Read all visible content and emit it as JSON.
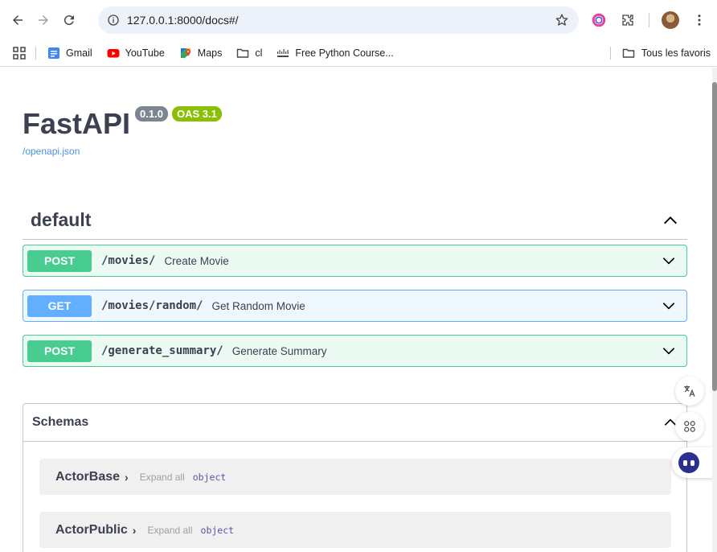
{
  "browser": {
    "url": "127.0.0.1:8000/docs#/",
    "bookmarks": [
      {
        "label": "Gmail",
        "icon": "gmail-icon"
      },
      {
        "label": "YouTube",
        "icon": "youtube-icon"
      },
      {
        "label": "Maps",
        "icon": "maps-icon"
      },
      {
        "label": "cl",
        "icon": "folder-icon"
      },
      {
        "label": "Free Python Course...",
        "icon": "cisco-icon"
      }
    ],
    "all_bookmarks": "Tous les favoris"
  },
  "api": {
    "title": "FastAPI",
    "version": "0.1.0",
    "oas": "OAS 3.1",
    "openapi_link": "/openapi.json"
  },
  "tag": {
    "name": "default",
    "operations": [
      {
        "method": "POST",
        "path": "/movies/",
        "summary": "Create Movie"
      },
      {
        "method": "GET",
        "path": "/movies/random/",
        "summary": "Get Random Movie"
      },
      {
        "method": "POST",
        "path": "/generate_summary/",
        "summary": "Generate Summary"
      }
    ]
  },
  "schemas": {
    "title": "Schemas",
    "models": [
      {
        "name": "ActorBase",
        "expand": "Expand all",
        "type": "object"
      },
      {
        "name": "ActorPublic",
        "expand": "Expand all",
        "type": "object"
      }
    ]
  },
  "colors": {
    "post": "#49cc90",
    "get": "#61affe",
    "oas": "#89bf04",
    "version": "#7d8492",
    "link": "#4990e2"
  }
}
